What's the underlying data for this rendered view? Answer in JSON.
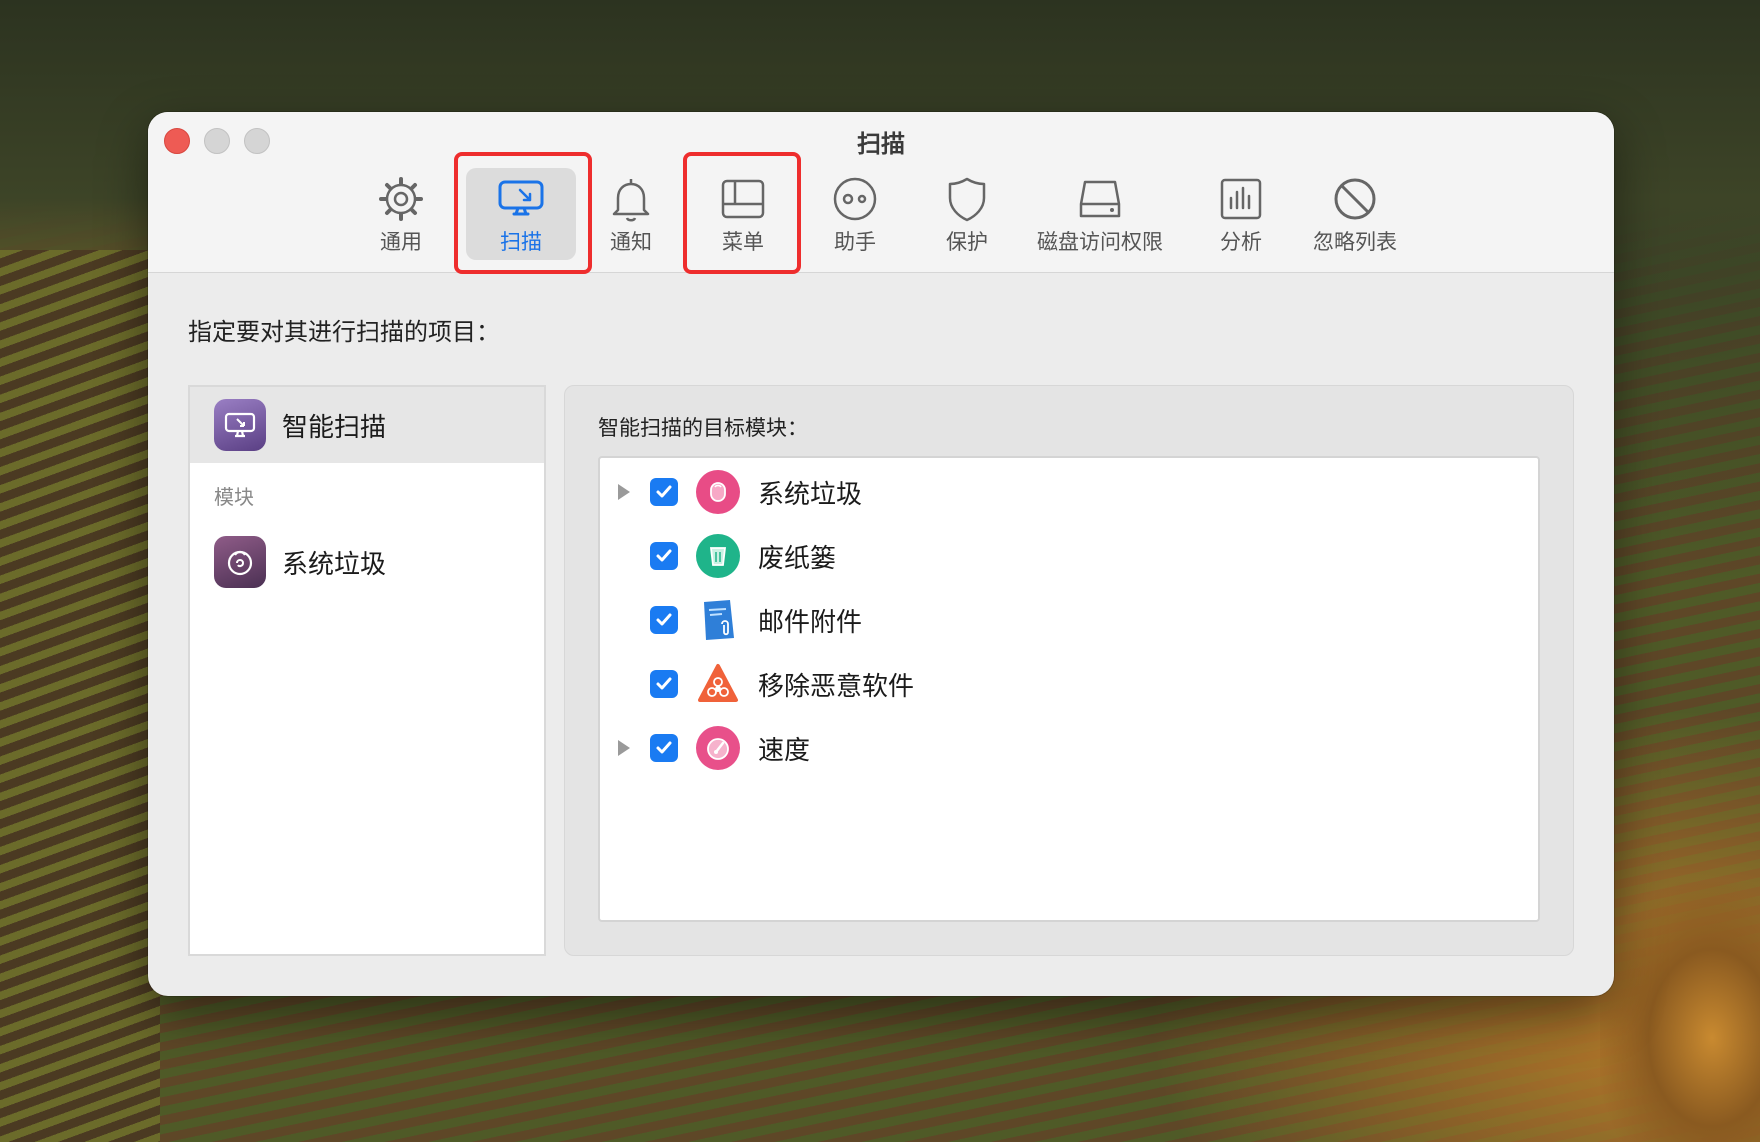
{
  "window": {
    "title": "扫描"
  },
  "toolbar": {
    "items": [
      {
        "label": "通用",
        "icon": "gear-icon"
      },
      {
        "label": "扫描",
        "icon": "scan-display-icon",
        "selected": true
      },
      {
        "label": "通知",
        "icon": "bell-icon"
      },
      {
        "label": "菜单",
        "icon": "menu-window-icon"
      },
      {
        "label": "助手",
        "icon": "assistant-face-icon"
      },
      {
        "label": "保护",
        "icon": "shield-icon"
      },
      {
        "label": "磁盘访问权限",
        "icon": "disk-icon"
      },
      {
        "label": "分析",
        "icon": "bar-chart-icon"
      },
      {
        "label": "忽略列表",
        "icon": "prohibited-icon"
      }
    ]
  },
  "content": {
    "prompt": "指定要对其进行扫描的项目："
  },
  "left_pane": {
    "smart_scan": {
      "label": "智能扫描",
      "icon": "smart-scan-icon"
    },
    "section_header": "模块",
    "modules": [
      {
        "label": "系统垃圾",
        "icon": "system-junk-icon"
      }
    ]
  },
  "right_pane": {
    "label": "智能扫描的目标模块：",
    "targets": [
      {
        "label": "系统垃圾",
        "checked": true,
        "expandable": true,
        "icon": "system-junk-icon",
        "color": "#e84c86"
      },
      {
        "label": "废纸篓",
        "checked": true,
        "expandable": false,
        "icon": "trash-bin-icon",
        "color": "#1fb48a"
      },
      {
        "label": "邮件附件",
        "checked": true,
        "expandable": false,
        "icon": "mail-attachment-icon",
        "color": "#2f7fd8"
      },
      {
        "label": "移除恶意软件",
        "checked": true,
        "expandable": false,
        "icon": "biohazard-icon",
        "color": "#f0623a"
      },
      {
        "label": "速度",
        "checked": true,
        "expandable": true,
        "icon": "speed-gauge-icon",
        "color": "#e8508a"
      }
    ]
  },
  "colors": {
    "accent": "#1a7bf2",
    "highlight_box": "#ee2d2d",
    "close_button": "#ee5b54"
  }
}
